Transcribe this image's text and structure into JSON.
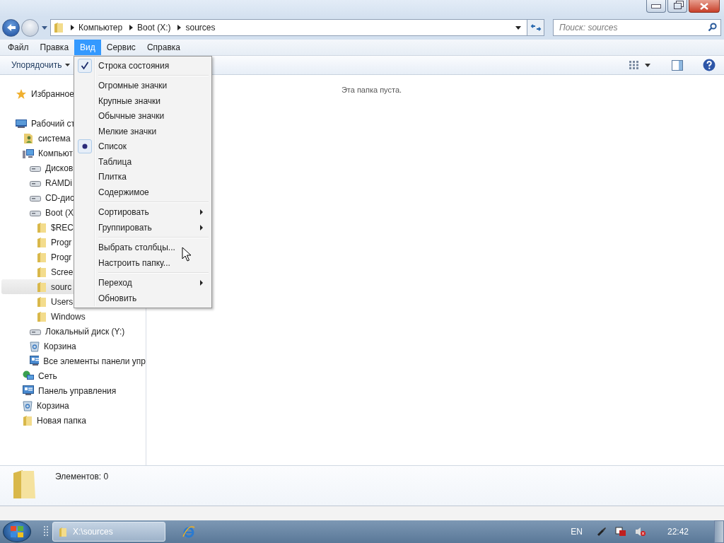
{
  "address": {
    "crumbs": [
      "Компьютер",
      "Boot (X:)",
      "sources"
    ]
  },
  "search": {
    "placeholder": "Поиск: sources"
  },
  "menubar": [
    {
      "label": "Файл",
      "selected": false
    },
    {
      "label": "Правка",
      "selected": false
    },
    {
      "label": "Вид",
      "selected": true
    },
    {
      "label": "Сервис",
      "selected": false
    },
    {
      "label": "Справка",
      "selected": false
    }
  ],
  "toolbar": {
    "organize": "Упорядочить"
  },
  "tree": [
    {
      "label": "Избранное",
      "kind": "star",
      "selected": false
    },
    {
      "label": "Рабочий ст",
      "kind": "desktop",
      "selected": false,
      "children": [
        {
          "label": "система",
          "kind": "user",
          "selected": false
        },
        {
          "label": "Компьют",
          "kind": "computer",
          "selected": false,
          "children": [
            {
              "label": "Дисков",
              "kind": "drive",
              "selected": false
            },
            {
              "label": "RAMDi",
              "kind": "drive",
              "selected": false
            },
            {
              "label": "CD-дис",
              "kind": "drive",
              "selected": false
            },
            {
              "label": "Boot (X",
              "kind": "drive",
              "selected": false,
              "children": [
                {
                  "label": "$REC",
                  "kind": "folder",
                  "selected": false
                },
                {
                  "label": "Progr",
                  "kind": "folder",
                  "selected": false
                },
                {
                  "label": "Progr",
                  "kind": "folder",
                  "selected": false
                },
                {
                  "label": "Scree",
                  "kind": "folder",
                  "selected": false
                },
                {
                  "label": "sourc",
                  "kind": "folder",
                  "selected": true
                },
                {
                  "label": "Users",
                  "kind": "folder",
                  "selected": false
                },
                {
                  "label": "Windows",
                  "kind": "folder",
                  "selected": false
                }
              ]
            },
            {
              "label": "Локальный диск (Y:)",
              "kind": "drive",
              "selected": false
            },
            {
              "label": "Корзина",
              "kind": "bin",
              "selected": false
            },
            {
              "label": "Все элементы панели упр",
              "kind": "panel",
              "selected": false
            }
          ]
        },
        {
          "label": "Сеть",
          "kind": "network",
          "selected": false
        },
        {
          "label": "Панель управления",
          "kind": "panel",
          "selected": false
        },
        {
          "label": "Корзина",
          "kind": "bin",
          "selected": false
        },
        {
          "label": "Новая папка",
          "kind": "folder",
          "selected": false
        }
      ]
    }
  ],
  "empty_message": "Эта папка пуста.",
  "menu": {
    "groups": [
      [
        {
          "label": "Строка состояния",
          "kind": "check",
          "checked": true
        }
      ],
      [
        {
          "label": "Огромные значки",
          "kind": "radio",
          "selected": false
        },
        {
          "label": "Крупные значки",
          "kind": "radio",
          "selected": false
        },
        {
          "label": "Обычные значки",
          "kind": "radio",
          "selected": false
        },
        {
          "label": "Мелкие значки",
          "kind": "radio",
          "selected": false
        },
        {
          "label": "Список",
          "kind": "radio",
          "selected": true
        },
        {
          "label": "Таблица",
          "kind": "radio",
          "selected": false
        },
        {
          "label": "Плитка",
          "kind": "radio",
          "selected": false
        },
        {
          "label": "Содержимое",
          "kind": "radio",
          "selected": false
        }
      ],
      [
        {
          "label": "Сортировать",
          "kind": "submenu"
        },
        {
          "label": "Группировать",
          "kind": "submenu"
        }
      ],
      [
        {
          "label": "Выбрать столбцы...",
          "kind": "plain"
        },
        {
          "label": "Настроить папку...",
          "kind": "plain"
        }
      ],
      [
        {
          "label": "Переход",
          "kind": "submenu"
        },
        {
          "label": "Обновить",
          "kind": "plain"
        }
      ]
    ]
  },
  "details": {
    "count": "Элементов: 0"
  },
  "taskbar": {
    "window": "X:\\sources",
    "language": "EN",
    "clock": "22:42"
  }
}
